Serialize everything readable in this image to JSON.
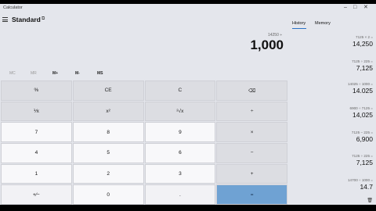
{
  "app": {
    "title": "Calculator",
    "mode": "Standard"
  },
  "display": {
    "expression": "14250 ÷",
    "value": "1,000"
  },
  "memory_buttons": [
    "MC",
    "MR",
    "M+",
    "M-",
    "MS"
  ],
  "keys": [
    [
      "%",
      "CE",
      "C",
      "⌫"
    ],
    [
      "⅟x",
      "x²",
      "²√x",
      "÷"
    ],
    [
      "7",
      "8",
      "9",
      "×"
    ],
    [
      "4",
      "5",
      "6",
      "−"
    ],
    [
      "1",
      "2",
      "3",
      "+"
    ],
    [
      "+⁄−",
      "0",
      ".",
      "="
    ]
  ],
  "history_panel": {
    "tabs": [
      "History",
      "Memory"
    ],
    "entries": [
      {
        "expression": "7125 ×   2 =",
        "result": "14,250"
      },
      {
        "expression": "7125 ÷   225 =",
        "result": "7,125"
      },
      {
        "expression": "14025 ÷ 1000 =",
        "result": "14.025"
      },
      {
        "expression": "6900 ÷ 7125 =",
        "result": "14,025"
      },
      {
        "expression": "7125 − 225 =",
        "result": "6,900"
      },
      {
        "expression": "7125 ÷   225 =",
        "result": "7,125"
      },
      {
        "expression": "14700 ÷ 1000 =",
        "result": "14.7"
      }
    ]
  },
  "colors": {
    "accent": "#2a72c6",
    "equals": "#6fa2d3",
    "background": "#e4e6ec"
  }
}
